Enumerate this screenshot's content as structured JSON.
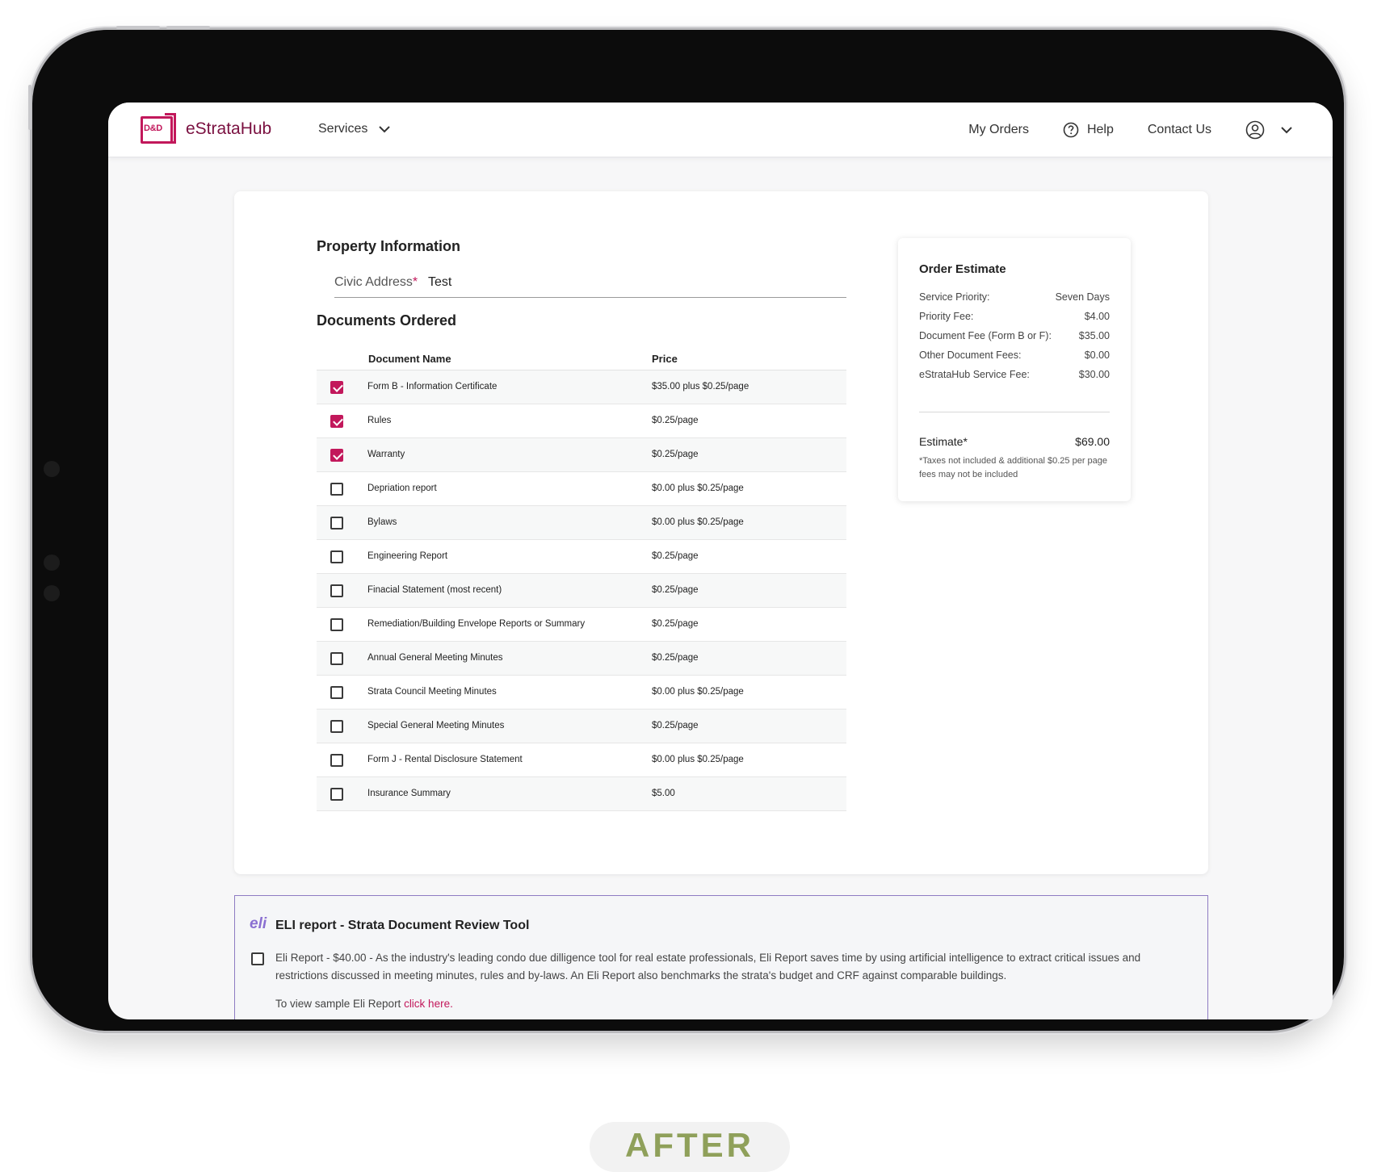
{
  "header": {
    "logo_mark": "D&D",
    "brand_name": "eStrataHub",
    "services_label": "Services",
    "my_orders_label": "My Orders",
    "help_label": "Help",
    "contact_label": "Contact Us"
  },
  "property": {
    "title": "Property Information",
    "civic_label": "Civic Address",
    "required_mark": "*",
    "civic_value": "Test"
  },
  "documents": {
    "title": "Documents Ordered",
    "col_name": "Document Name",
    "col_price": "Price",
    "rows": [
      {
        "name": "Form B - Information Certificate",
        "price": "$35.00 plus $0.25/page",
        "checked": true
      },
      {
        "name": "Rules",
        "price": "$0.25/page",
        "checked": true
      },
      {
        "name": "Warranty",
        "price": "$0.25/page",
        "checked": true
      },
      {
        "name": "Depriation report",
        "price": "$0.00 plus $0.25/page",
        "checked": false
      },
      {
        "name": "Bylaws",
        "price": "$0.00 plus $0.25/page",
        "checked": false
      },
      {
        "name": "Engineering Report",
        "price": "$0.25/page",
        "checked": false
      },
      {
        "name": "Finacial Statement (most recent)",
        "price": "$0.25/page",
        "checked": false
      },
      {
        "name": "Remediation/Building Envelope Reports or Summary",
        "price": "$0.25/page",
        "checked": false
      },
      {
        "name": "Annual General Meeting Minutes",
        "price": "$0.25/page",
        "checked": false
      },
      {
        "name": "Strata Council Meeting Minutes",
        "price": "$0.00 plus $0.25/page",
        "checked": false
      },
      {
        "name": "Special General Meeting Minutes",
        "price": "$0.25/page",
        "checked": false
      },
      {
        "name": "Form J - Rental Disclosure Statement",
        "price": "$0.00 plus $0.25/page",
        "checked": false
      },
      {
        "name": "Insurance Summary",
        "price": "$5.00",
        "checked": false
      }
    ]
  },
  "estimate": {
    "title": "Order Estimate",
    "rows": [
      {
        "label": "Service Priority:",
        "value": "Seven Days"
      },
      {
        "label": "Priority Fee:",
        "value": "$4.00"
      },
      {
        "label": "Document Fee (Form B or F):",
        "value": "$35.00"
      },
      {
        "label": "Other Document Fees:",
        "value": "$0.00"
      },
      {
        "label": "eStrataHub Service Fee:",
        "value": "$30.00"
      }
    ],
    "total_label": "Estimate*",
    "total_value": "$69.00",
    "note": "*Taxes not included & additional $0.25 per page fees may not be included"
  },
  "eli": {
    "logo": "eli",
    "title": "ELI report - Strata Document Review Tool",
    "description": "Eli Report - $40.00 - As the industry's leading condo due dilligence tool for real estate professionals, Eli Report saves time by using artificial intelligence to extract critical issues and restrictions discussed in meeting minutes, rules and by-laws. An Eli Report also benchmarks the strata's budget and CRF against comparable buildings.",
    "sample_prefix": "To view sample Eli Report ",
    "sample_link": "click here."
  },
  "badge": {
    "label": "AFTER"
  },
  "colors": {
    "accent": "#c2185b",
    "brand_text": "#7a1040",
    "eli_border": "#8e7cc3",
    "badge_text": "#8fa05a"
  }
}
